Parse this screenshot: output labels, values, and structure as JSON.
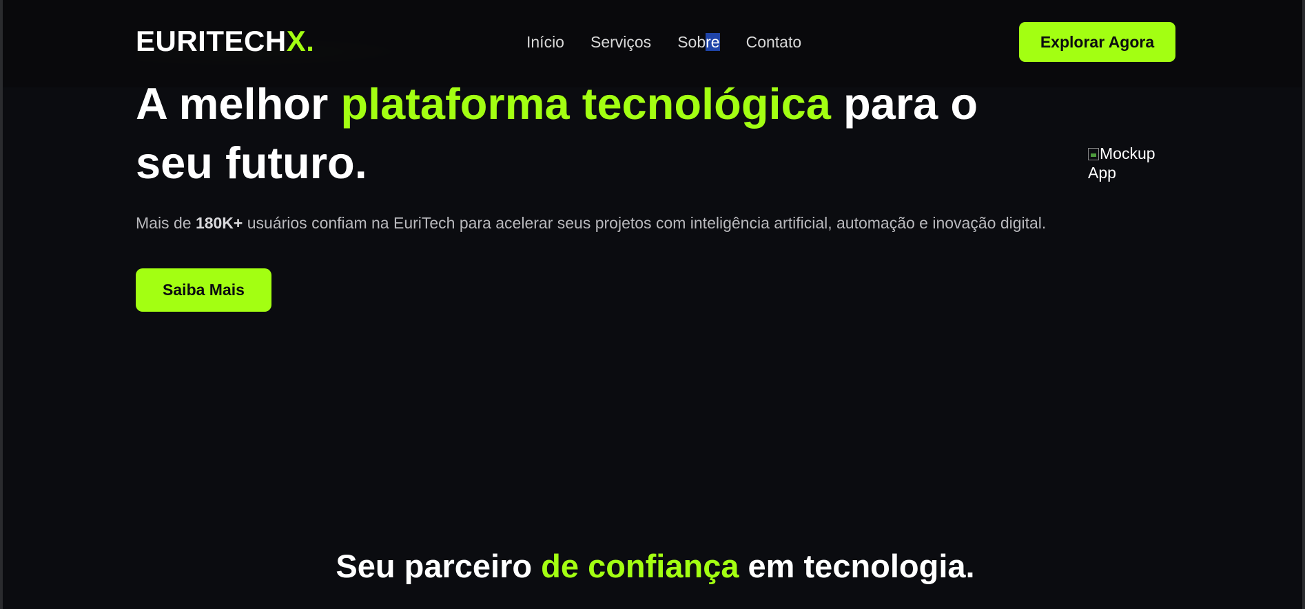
{
  "header": {
    "logo_main": "EURITECH",
    "logo_accent": "X.",
    "nav": [
      {
        "label": "Início"
      },
      {
        "label": "Serviços"
      },
      {
        "label_before": "Sob",
        "label_selected": "re"
      },
      {
        "label": "Contato"
      }
    ],
    "cta_label": "Explorar Agora"
  },
  "hero": {
    "title_before": "A melhor ",
    "title_accent": "plataforma tecnológica",
    "title_after": " para o seu futuro.",
    "text_before": "Mais de ",
    "text_strong": "180K+",
    "text_after": " usuários confiam na EuriTech para acelerar seus projetos com inteligência artificial, automação e inovação digital.",
    "cta_label": "Saiba Mais",
    "image_alt": "Mockup App"
  },
  "section": {
    "title_before": "Seu parceiro ",
    "title_accent": "de confiança",
    "title_after": " em tecnologia."
  },
  "colors": {
    "background": "#0b0c10",
    "accent": "#a3ff12",
    "text": "#ffffff",
    "muted_text": "#b9b9bd",
    "selection": "#1f44a8"
  }
}
